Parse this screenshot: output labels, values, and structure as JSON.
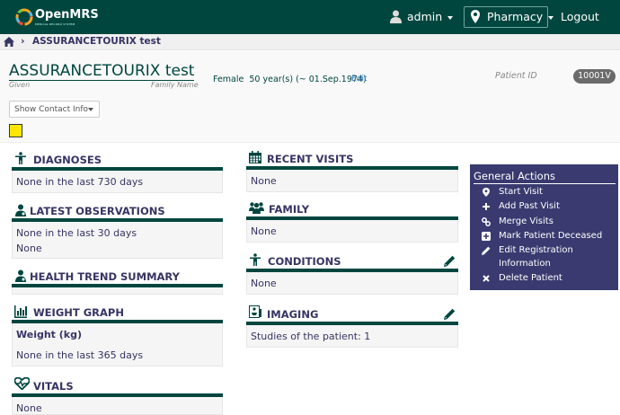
{
  "header": {
    "logo_text": "OpenMRS",
    "logo_subtext": "MEDICAL RECORD SYSTEM",
    "user": "admin",
    "location": "Pharmacy",
    "logout": "Logout",
    "bg_color": "#00463f"
  },
  "breadcrumb": {
    "current": "ASSURANCETOURIX test"
  },
  "patient": {
    "name": "ASSURANCETOURIX test",
    "given_label": "Given",
    "family_label": "Family Name",
    "demographics": "Female  50 year(s) (~ 01.Sep.1974)",
    "edit_link": "Edit",
    "id_label": "Patient ID",
    "id_value": "10001V",
    "contact_button": "Show Contact Info"
  },
  "left_col": {
    "diagnoses": {
      "title": "DIAGNOSES",
      "line1": "None in the last 730 days"
    },
    "observations": {
      "title": "LATEST OBSERVATIONS",
      "line1": "None in the last 30 days",
      "line2": "None"
    },
    "health_trend": {
      "title": "HEALTH TREND SUMMARY"
    },
    "weight": {
      "title": "WEIGHT GRAPH",
      "subtitle": "Weight (kg)",
      "line1": "None in the last 365 days"
    },
    "vitals": {
      "title": "VITALS",
      "line1": "None"
    }
  },
  "mid_col": {
    "recent_visits": {
      "title": "RECENT VISITS",
      "line1": "None"
    },
    "family": {
      "title": "FAMILY",
      "line1": "None"
    },
    "conditions": {
      "title": "CONDITIONS",
      "line1": "None"
    },
    "imaging": {
      "title": "IMAGING",
      "line1": "Studies of the patient: 1"
    }
  },
  "general_actions": {
    "title": "General Actions",
    "items": [
      {
        "label": "Start Visit",
        "icon": "map-pin-icon"
      },
      {
        "label": "Add Past Visit",
        "icon": "plus-icon"
      },
      {
        "label": "Merge Visits",
        "icon": "link-icon"
      },
      {
        "label": "Mark Patient Deceased",
        "icon": "plus-square-icon"
      },
      {
        "label": "Edit Registration",
        "label2": "Information",
        "icon": "pencil-icon"
      },
      {
        "label": "Delete Patient",
        "icon": "close-icon"
      }
    ],
    "bg_color": "#3a3a70"
  }
}
